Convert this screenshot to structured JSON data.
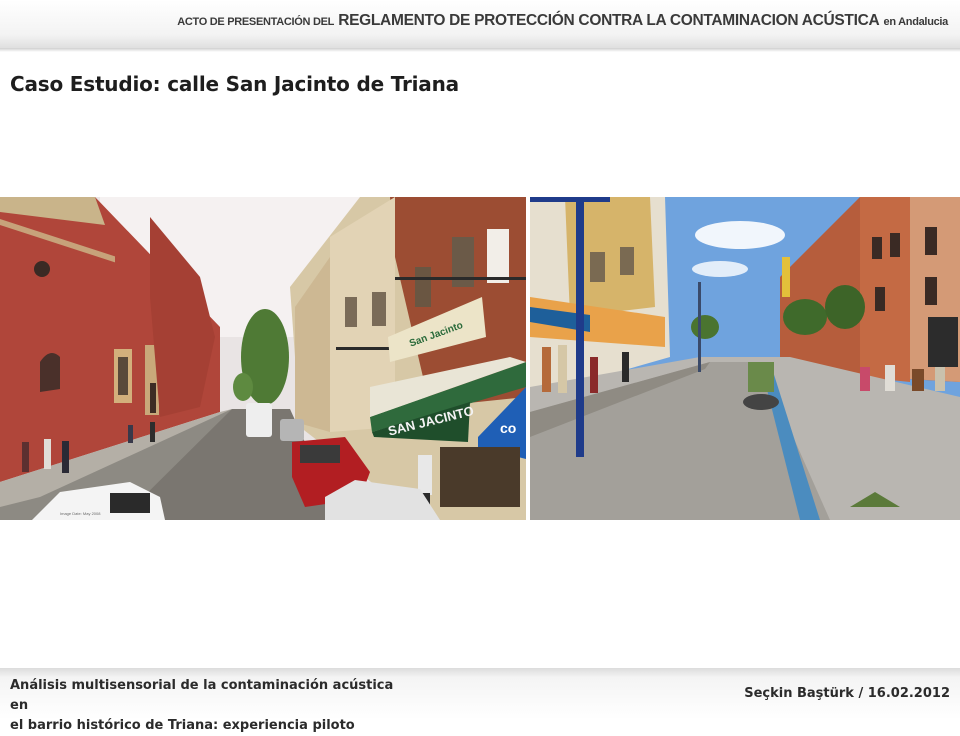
{
  "header": {
    "prefix": "ACTO DE PRESENTACIÓN DEL",
    "main": "REGLAMENTO DE PROTECCIÓN CONTRA LA CONTAMINACION ACÚSTICA",
    "suffix": "en Andalucia"
  },
  "title": "Caso Estudio: calle San Jacinto de Triana",
  "photos": {
    "left": {
      "awning_text": "SAN JACINTO",
      "shop_sign": "San Jacinto",
      "blue_sign": "co",
      "watermark": "Image Date: May 2008"
    },
    "right": {}
  },
  "footer": {
    "left_line1": "Análisis multisensorial de la contaminación acústica en",
    "left_line2": "el barrio histórico de Triana: experiencia piloto",
    "right": "Seçkin Baştürk / 16.02.2012"
  }
}
